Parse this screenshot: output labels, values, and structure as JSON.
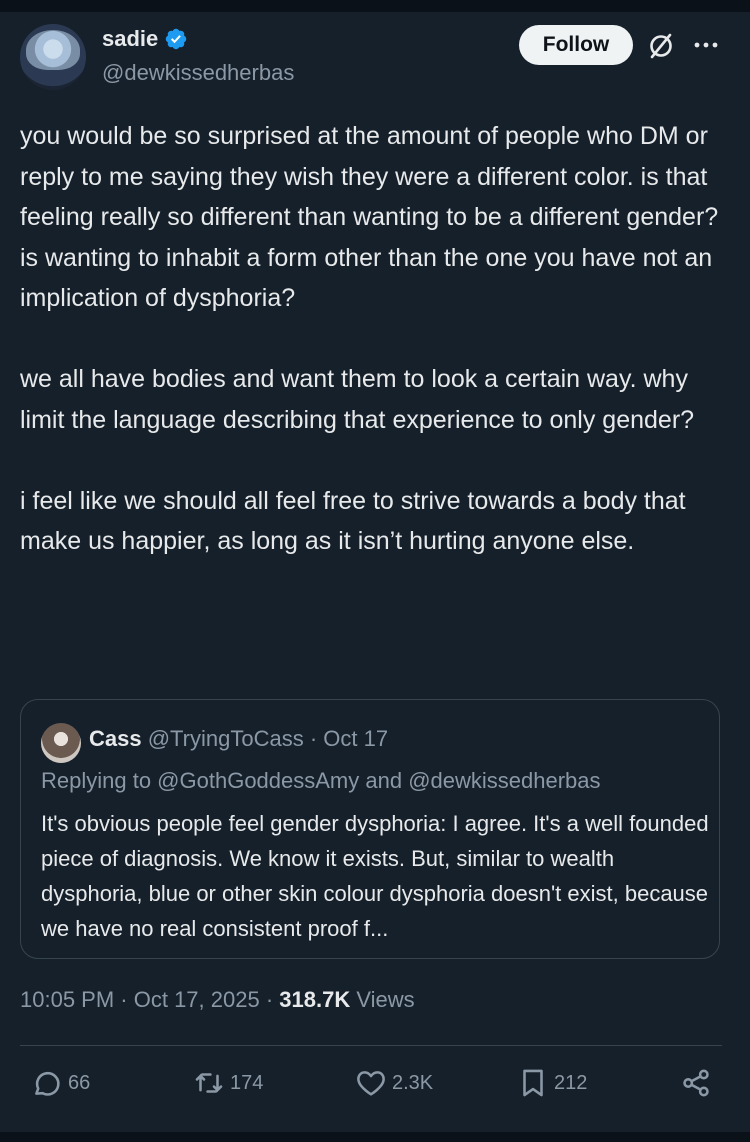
{
  "author": {
    "name": "sadie",
    "handle": "@dewkissedherbas",
    "verified_icon": "verified-badge-icon",
    "verified_color": "#1d9bf0"
  },
  "header": {
    "follow_label": "Follow",
    "grok_icon": "grok-icon",
    "more_icon": "more-horizontal-icon"
  },
  "post": {
    "paragraphs": [
      "you would be so surprised at the amount of people who DM or reply to me saying they wish they were a different color. is that feeling really so different than wanting to be a different gender? is wanting to inhabit a form other than the one you have not an implication of dysphoria?",
      "we all have bodies and want them to look a certain way. why limit the language describing that experience to only gender?",
      "i feel like we should all feel free to strive towards a body that make us happier, as long as it isn’t hurting anyone else."
    ]
  },
  "quote": {
    "name": "Cass",
    "handle": "@TryingToCass",
    "separator": " · ",
    "date": "Oct 17",
    "replying_to": "Replying to @GothGoddessAmy and @dewkissedherbas",
    "text": "It's obvious people feel gender dysphoria: I agree. It's a well founded piece of diagnosis. We know it exists. But, similar to wealth dysphoria, blue or other skin colour dysphoria doesn't exist, because we have no real consistent proof f..."
  },
  "meta": {
    "time": "10:05 PM",
    "date": "Oct 17, 2025",
    "separator": " · ",
    "views_count": "318.7K",
    "views_label": " Views"
  },
  "actions": {
    "replies": "66",
    "reposts": "174",
    "likes": "2.3K",
    "bookmarks": "212"
  },
  "colors": {
    "background": "#15202b",
    "text": "#e7e9ea",
    "secondary": "#8b98a5",
    "border": "#38444d"
  }
}
